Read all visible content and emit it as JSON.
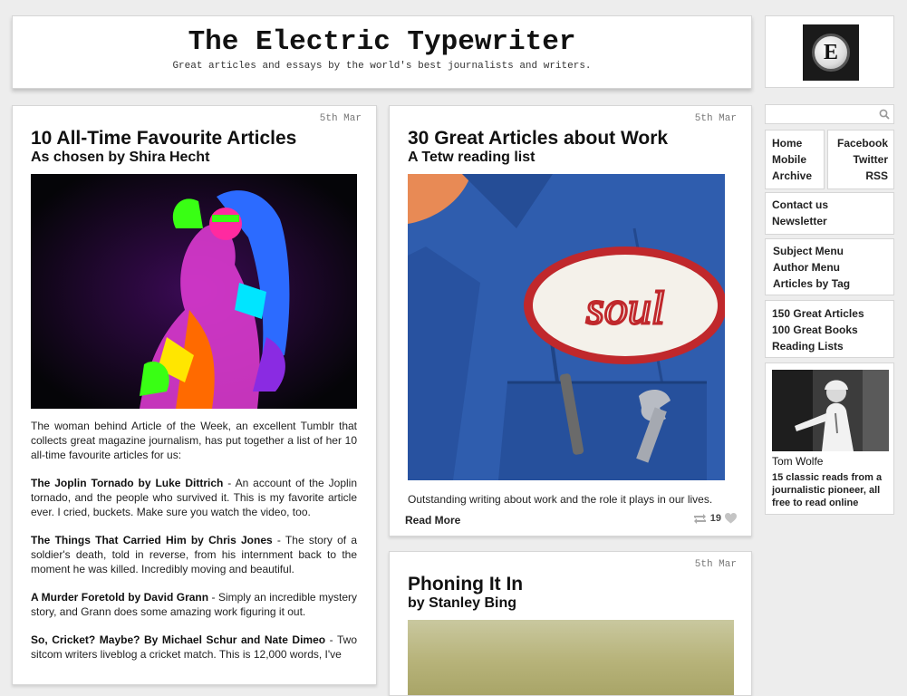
{
  "site": {
    "title": "The Electric Typewriter",
    "tagline": "Great articles and essays by the world's best journalists and writers.",
    "logo_letter": "E"
  },
  "posts": [
    {
      "date": "5th Mar",
      "title": "10 All-Time Favourite Articles",
      "subtitle": "As chosen by Shira Hecht",
      "intro": "The woman behind Article of the Week, an excellent Tumblr that collects great magazine journalism, has put together a list of her 10 all-time favourite articles for us:",
      "items": [
        {
          "title": "The Joplin Tornado by Luke Dittrich",
          "desc": " - An account of the Joplin tornado, and the people who survived it. This is my favorite article ever. I cried, buckets. Make sure you watch the video, too."
        },
        {
          "title": "The Things That Carried Him by Chris Jones",
          "desc": " - The story of a soldier's death, told in reverse, from his internment back to the moment he was killed. Incredibly moving and beautiful."
        },
        {
          "title": "A Murder Foretold by David Grann",
          "desc": " - Simply an incredible mystery story, and Grann does some amazing work figuring it out."
        },
        {
          "title": "So, Cricket? Maybe? By Michael Schur and Nate Dimeo",
          "desc": " - Two sitcom writers liveblog a cricket match. This is 12,000 words, I've"
        }
      ]
    },
    {
      "date": "5th Mar",
      "title": "30 Great Articles about Work",
      "subtitle": "A Tetw reading list",
      "excerpt": "Outstanding writing about work and the role it plays in our lives.",
      "read_more": "Read More",
      "notes": "19",
      "patch_text": "soul"
    },
    {
      "date": "5th Mar",
      "title": "Phoning It In",
      "subtitle": "by Stanley Bing"
    }
  ],
  "sidebar": {
    "search_placeholder": "",
    "nav_left": [
      "Home",
      "Mobile",
      "Archive"
    ],
    "nav_right": [
      "Facebook",
      "Twitter",
      "RSS"
    ],
    "contact": [
      "Contact us",
      "Newsletter"
    ],
    "menus": [
      "Subject Menu",
      "Author Menu",
      "Articles by Tag"
    ],
    "lists": [
      "150 Great Articles",
      "100 Great Books",
      "Reading Lists"
    ],
    "feature": {
      "name": "Tom Wolfe",
      "desc": "15 classic reads from a journalistic pioneer, all free to read online"
    }
  },
  "colors": {
    "background": "#ededed",
    "panel": "#ffffff",
    "border": "#d6d6d6",
    "patch_red": "#c0282c"
  }
}
